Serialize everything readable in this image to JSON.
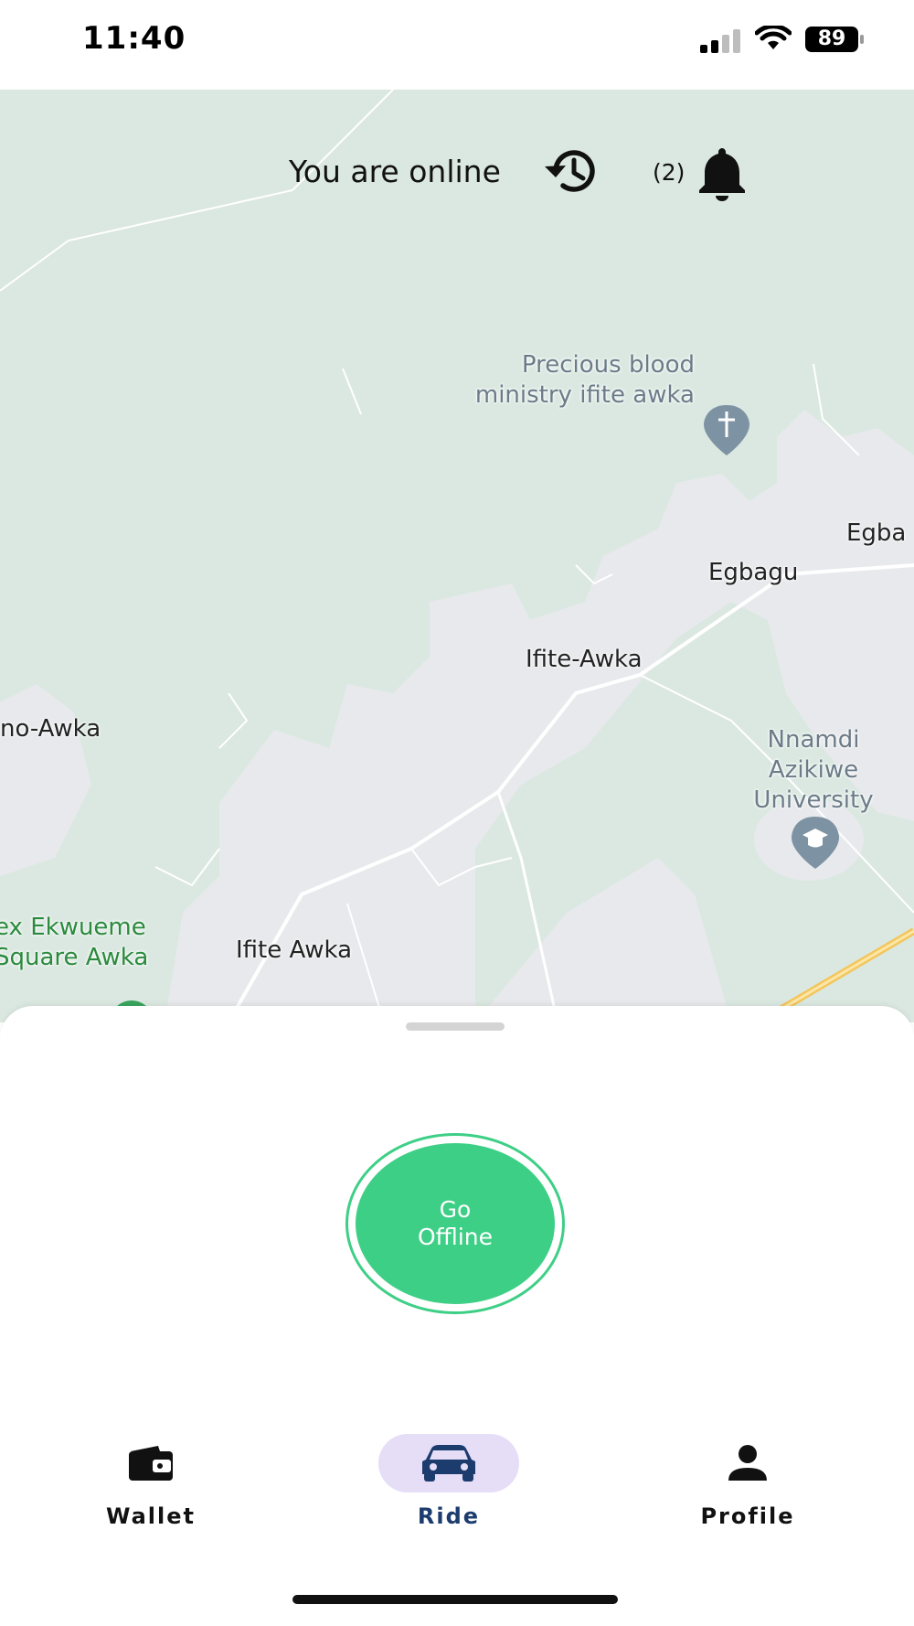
{
  "status_bar": {
    "time": "11:40",
    "battery": "89"
  },
  "header": {
    "online_text": "You are online",
    "notification_count": "(2)"
  },
  "map": {
    "labels": {
      "egbagu": "Egbagu",
      "egba_partial": "Egba",
      "ifite_awka_upper": "Ifite-Awka",
      "nimo_awka": "no-Awka",
      "ifite_awka_lower": "Ifite Awka"
    },
    "poi": {
      "church": "Precious blood\nministry ifite awka",
      "university": "Nnamdi\nAzikiwe\nUniversity",
      "park": "ex Ekwueme\nSquare Awka"
    }
  },
  "sheet": {
    "go_offline_label": "Go\nOffline"
  },
  "nav": {
    "items": [
      {
        "label": "Wallet",
        "icon": "wallet-icon",
        "active": false
      },
      {
        "label": "Ride",
        "icon": "car-icon",
        "active": true
      },
      {
        "label": "Profile",
        "icon": "person-icon",
        "active": false
      }
    ]
  },
  "colors": {
    "accent_green": "#3ecf86",
    "active_nav_bg": "#e6ddf7",
    "active_nav_text": "#1c3c6e",
    "map_green": "#dbe8e1",
    "map_gray": "#e8e9ec"
  }
}
